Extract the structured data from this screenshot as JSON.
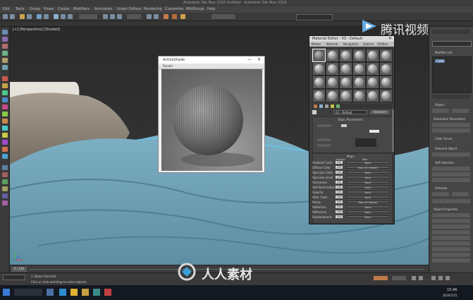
{
  "app": {
    "title": "Autodesk 3ds Max 2016    Untitled - Autodesk 3ds Max 2016"
  },
  "menubar": {
    "items": [
      "Edit",
      "Tools",
      "Group",
      "Views",
      "Create",
      "Modifiers",
      "Animation",
      "Graph Editors",
      "Rendering",
      "Customize",
      "MAXScript",
      "Help"
    ]
  },
  "viewport": {
    "label": "[+] [Perspective] [Shaded]"
  },
  "render_window": {
    "title": "ActiveShade",
    "toolbar_label": "Render"
  },
  "material_editor": {
    "title": "Material Editor - 03 - Default",
    "menu": [
      "Modes",
      "Material",
      "Navigation",
      "Options",
      "Utilities"
    ],
    "material_name": "03 - Default",
    "rollout_labels": [
      "Standard",
      "Basic Parameters",
      "Maps"
    ],
    "maps_header": [
      "Amount",
      "Map"
    ],
    "maps": [
      {
        "name": "Ambient Color",
        "amount": "100",
        "map": "None"
      },
      {
        "name": "Diffuse Color",
        "amount": "100",
        "map": "Map #2 (Falloff)"
      },
      {
        "name": "Specular Color",
        "amount": "100",
        "map": "None"
      },
      {
        "name": "Specular Level",
        "amount": "100",
        "map": "None"
      },
      {
        "name": "Glossiness",
        "amount": "100",
        "map": "None"
      },
      {
        "name": "Self-Illumination",
        "amount": "100",
        "map": "None"
      },
      {
        "name": "Opacity",
        "amount": "100",
        "map": "None"
      },
      {
        "name": "Filter Color",
        "amount": "100",
        "map": "None"
      },
      {
        "name": "Bump",
        "amount": "100",
        "map": "Map #3 (Noise)"
      },
      {
        "name": "Reflection",
        "amount": "100",
        "map": "None"
      },
      {
        "name": "Refraction",
        "amount": "100",
        "map": "None"
      },
      {
        "name": "Displacement",
        "amount": "100",
        "map": "None"
      }
    ]
  },
  "command_panel": {
    "modifier_list": "Modifier List",
    "stack_item": "Cloth",
    "labels": [
      "Object",
      "Simulation Parameters",
      "Cloth Forces",
      "Selected Object",
      "Soft Selection",
      "Simulate",
      "Object Properties"
    ]
  },
  "timeline": {
    "frame": "0 / 100"
  },
  "status": {
    "message": "1 Object Selected",
    "hint": "Click or click-and-drag to select objects"
  },
  "taskbar": {
    "time": "15:46",
    "date": "2016/7/15"
  },
  "watermarks": {
    "top": "腾讯视频",
    "bottom": "人人素材"
  }
}
